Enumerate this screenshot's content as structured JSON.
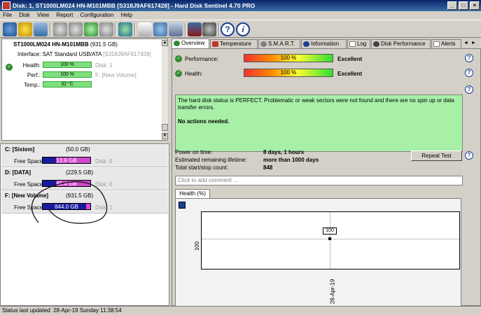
{
  "window": {
    "title": "Disk: 1, ST1000LM024 HN-M101MBB [S318J9AF617428]  -  Hard Disk Sentinel 4.70 PRO"
  },
  "menu": {
    "file": "File",
    "disk": "Disk",
    "view": "View",
    "report": "Report",
    "configuration": "Configuration",
    "help": "Help"
  },
  "disk": {
    "model": "ST1000LM024 HN-M101MBB",
    "size": "(931.5 GB)",
    "interface_label": "Interface:",
    "interface_value": "SAT Standard USB/ATA",
    "serial": "[S318J9AF617428]",
    "health_label": "Health:",
    "health_value": "100 %",
    "health_extra": "Disk: 1",
    "perf_label": "Perf.:",
    "perf_value": "100 %",
    "perf_extra": "F: [New Volume]",
    "temp_label": "Temp.:",
    "temp_value": "32 °C"
  },
  "partitions": [
    {
      "name": "C: [Sistem]",
      "size": "(50.0 GB)",
      "free_label": "Free Space",
      "free": "13.9 GB",
      "disk": "Disk: 0",
      "color": "#1a1aa0",
      "fill": 0.28
    },
    {
      "name": "D: [DATA]",
      "size": "(229.5 GB)",
      "free_label": "Free Space",
      "free": "65.4 GB",
      "disk": "Disk: 0",
      "color": "#1a1aa0",
      "fill": 0.29
    },
    {
      "name": "F: [New Volume]",
      "size": "(931.5 GB)",
      "free_label": "Free Space",
      "free": "844.0 GB",
      "disk": "Disk: 1",
      "color": "#1a1aa0",
      "fill": 0.91
    }
  ],
  "tabs": [
    "Overview",
    "Temperature",
    "S.M.A.R.T.",
    "Information",
    "Log",
    "Disk Performance",
    "Alerts"
  ],
  "overview": {
    "perf_label": "Performance:",
    "perf_value": "100 %",
    "perf_rating": "Excellent",
    "perf_fill": 1.0,
    "health_label": "Health:",
    "health_value": "100 %",
    "health_rating": "Excellent",
    "health_fill": 1.0,
    "status_text": "The hard disk status is PERFECT. Problematic or weak sectors were not found and there are no spin up or data transfer errors.",
    "actions_text": "No actions needed.",
    "power_on_label": "Power on time:",
    "power_on_value": "8 days, 1 hours",
    "lifetime_label": "Estimated remaining lifetime:",
    "lifetime_value": "more than 1000 days",
    "startstop_label": "Total start/stop count:",
    "startstop_value": "848",
    "repeat_button": "Repeat Test",
    "comment_placeholder": "Click to add comment ..."
  },
  "health_tab": "Health (%)",
  "chart_data": {
    "type": "line",
    "x": [
      "28-Apr-19"
    ],
    "series": [
      {
        "values": [
          100
        ]
      }
    ],
    "ytick": "100",
    "xtick": "28-Apr-19",
    "data_label": "100"
  },
  "statusbar": {
    "text": "Status last updated: 28-Apr-19 Sunday 11:38:54"
  },
  "colors": {
    "title_bg": "#0a246a",
    "status_green": "#a8f0a8",
    "bar_green": "#7fe07f"
  }
}
